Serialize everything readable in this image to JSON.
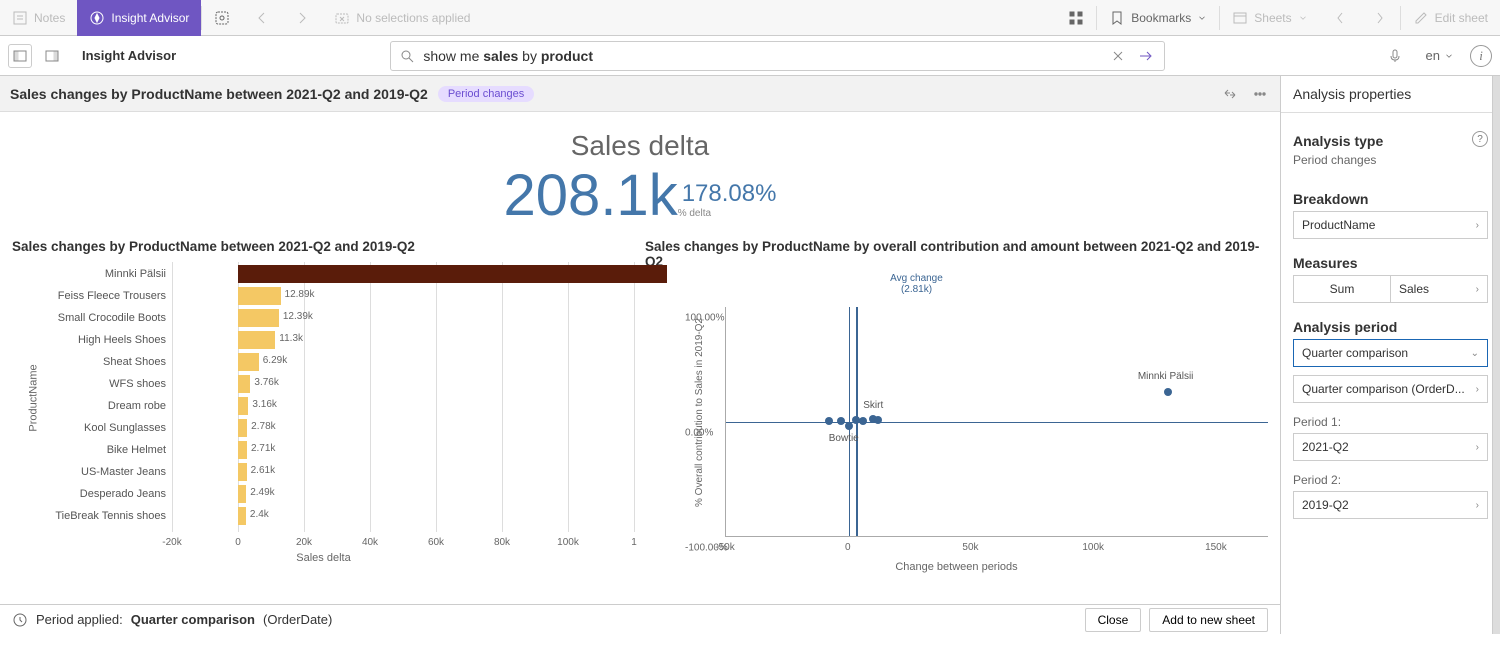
{
  "toolbar": {
    "notes": "Notes",
    "insight_advisor": "Insight Advisor",
    "no_selections": "No selections applied",
    "bookmarks": "Bookmarks",
    "sheets": "Sheets",
    "edit_sheet": "Edit sheet"
  },
  "second_row": {
    "title": "Insight Advisor",
    "search_value": "show me sales by product",
    "lang": "en"
  },
  "analysis_header": {
    "title": "Sales changes by ProductName between 2021-Q2 and 2019-Q2",
    "badge": "Period changes"
  },
  "kpi": {
    "title": "Sales delta",
    "value": "208.1k",
    "pct": "178.08%",
    "sub": "% delta"
  },
  "bar_chart": {
    "title": "Sales changes by ProductName between 2021-Q2 and 2019-Q2",
    "y_axis_label": "ProductName",
    "x_axis_label": "Sales delta"
  },
  "scatter": {
    "title": "Sales changes by ProductName by overall contribution and amount between 2021-Q2 and 2019-Q2",
    "y_axis_label": "% Overall contribution to Sales in 2019-Q2",
    "x_axis_label": "Change between periods",
    "avg_label": "Avg change",
    "avg_value": "(2.81k)"
  },
  "footer": {
    "period_applied": "Period applied:",
    "period_value": "Quarter comparison",
    "period_field": "(OrderDate)",
    "close": "Close",
    "add_new": "Add to new sheet"
  },
  "right": {
    "header": "Analysis properties",
    "analysis_type_label": "Analysis type",
    "analysis_type_value": "Period changes",
    "breakdown_label": "Breakdown",
    "breakdown_value": "ProductName",
    "measures_label": "Measures",
    "measure_agg": "Sum",
    "measure_field": "Sales",
    "analysis_period_label": "Analysis period",
    "period_select": "Quarter comparison",
    "period_detail": "Quarter comparison (OrderD...",
    "period1_label": "Period 1:",
    "period1_value": "2021-Q2",
    "period2_label": "Period 2:",
    "period2_value": "2019-Q2"
  },
  "chart_data": [
    {
      "type": "bar",
      "title": "Sales changes by ProductName between 2021-Q2 and 2019-Q2",
      "xlabel": "Sales delta",
      "ylabel": "ProductName",
      "categories": [
        "Minnki Pälsii",
        "Feiss Fleece Trousers",
        "Small Crocodile Boots",
        "High Heels Shoes",
        "Sheat Shoes",
        "WFS shoes",
        "Dream robe",
        "Kool Sunglasses",
        "Bike Helmet",
        "US-Master Jeans",
        "Desperado Jeans",
        "TieBreak Tennis shoes"
      ],
      "values": [
        130000,
        12890,
        12390,
        11300,
        6290,
        3760,
        3160,
        2780,
        2710,
        2610,
        2490,
        2400
      ],
      "labels": [
        "",
        "12.89k",
        "12.39k",
        "11.3k",
        "6.29k",
        "3.76k",
        "3.16k",
        "2.78k",
        "2.71k",
        "2.61k",
        "2.49k",
        "2.4k"
      ],
      "colors": [
        "#5a1c0a",
        "#f4c864",
        "#f4c864",
        "#f4c864",
        "#f4c864",
        "#f4c864",
        "#f4c864",
        "#f4c864",
        "#f4c864",
        "#f4c864",
        "#f4c864",
        "#f4c864"
      ],
      "x_ticks": [
        "-20k",
        "0",
        "20k",
        "40k",
        "60k",
        "80k",
        "100k",
        "1"
      ],
      "x_range": [
        -20000,
        120000
      ]
    },
    {
      "type": "scatter",
      "title": "Sales changes by ProductName by overall contribution and amount between 2021-Q2 and 2019-Q2",
      "xlabel": "Change between periods",
      "ylabel": "% Overall contribution to Sales in 2019-Q2",
      "x_range": [
        -50000,
        170000
      ],
      "y_range": [
        -100,
        100
      ],
      "x_ticks": [
        "-50k",
        "0",
        "50k",
        "100k",
        "150k"
      ],
      "y_ticks": [
        "-100.00%",
        "0.00%",
        "100.00%"
      ],
      "avg_change": 2810,
      "points": [
        {
          "name": "Minnki Pälsii",
          "x": 130000,
          "y": 25,
          "label": "Minnki Pälsii"
        },
        {
          "name": "Skirt",
          "x": 10000,
          "y": 2,
          "label": "Skirt"
        },
        {
          "name": "Bowtie",
          "x": 0,
          "y": -4,
          "label": "Bowtie"
        },
        {
          "name": "p1",
          "x": -8000,
          "y": 0
        },
        {
          "name": "p2",
          "x": -3000,
          "y": 0
        },
        {
          "name": "p3",
          "x": 3000,
          "y": 1
        },
        {
          "name": "p4",
          "x": 6000,
          "y": 0
        },
        {
          "name": "p5",
          "x": 12000,
          "y": 1
        }
      ]
    }
  ]
}
